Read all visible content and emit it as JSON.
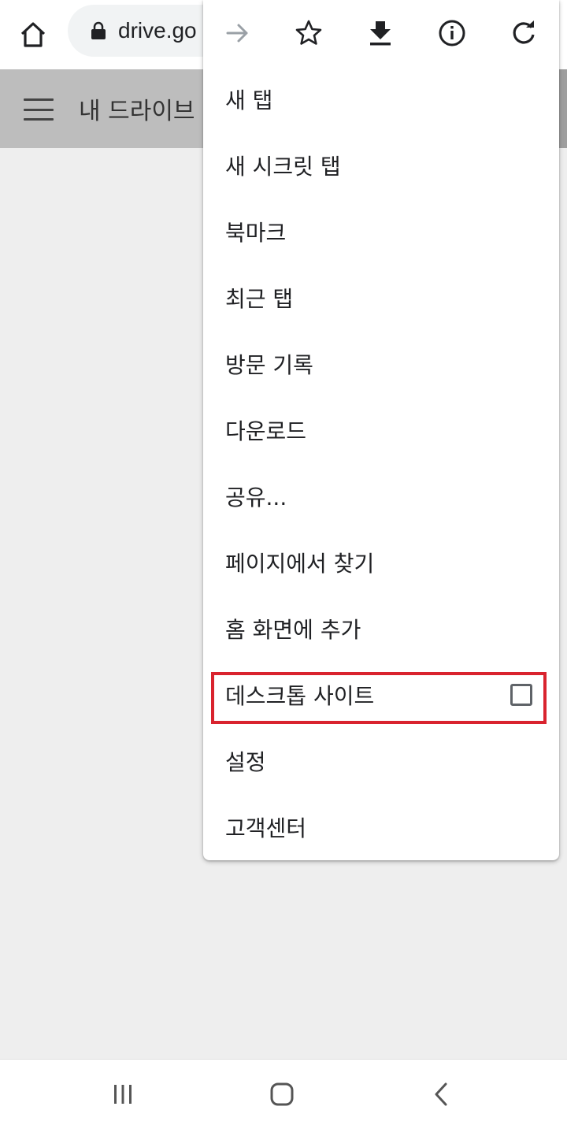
{
  "browser": {
    "url": "drive.go",
    "icons": {
      "home": "home-icon",
      "lock": "lock-icon"
    }
  },
  "page": {
    "title": "내 드라이브"
  },
  "menu": {
    "toolbar_icons": [
      "forward-arrow-icon",
      "star-icon",
      "download-icon",
      "info-icon",
      "refresh-icon"
    ],
    "items": [
      {
        "label": "새 탭"
      },
      {
        "label": "새 시크릿 탭"
      },
      {
        "label": "북마크"
      },
      {
        "label": "최근 탭"
      },
      {
        "label": "방문 기록"
      },
      {
        "label": "다운로드"
      },
      {
        "label": "공유..."
      },
      {
        "label": "페이지에서 찾기"
      },
      {
        "label": "홈 화면에 추가"
      },
      {
        "label": "데스크톱 사이트",
        "checked": false
      },
      {
        "label": "설정"
      },
      {
        "label": "고객센터"
      }
    ],
    "highlight_color": "#d9232e"
  },
  "navbar": {
    "icons": [
      "recent-apps-icon",
      "home-nav-icon",
      "back-icon"
    ]
  }
}
